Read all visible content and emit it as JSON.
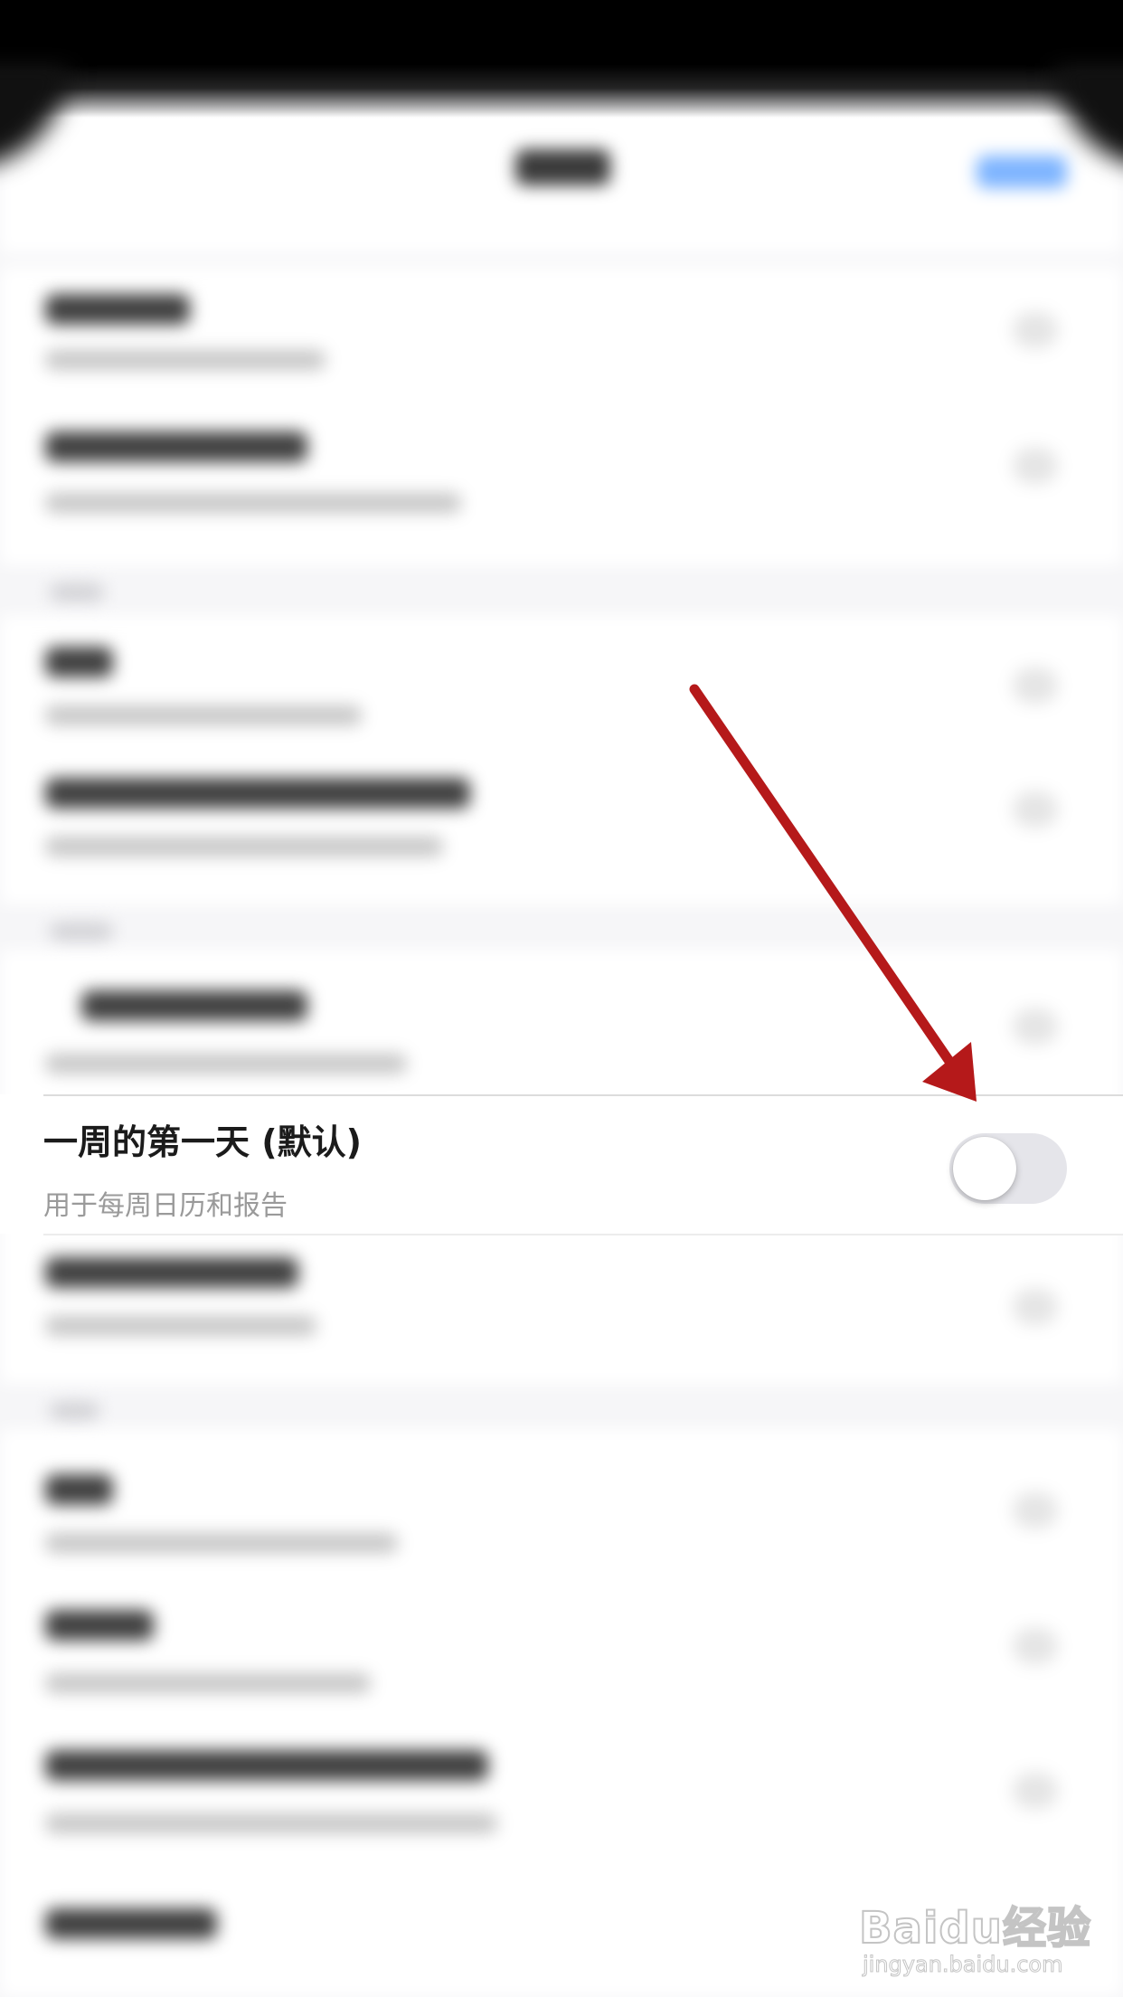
{
  "setting_row": {
    "title": "一周的第一天 (默认)",
    "subtitle": "用于每周日历和报告",
    "toggle_on": false
  },
  "watermark": {
    "logo_text": "Baidu经验",
    "url": "jingyan.baidu.com"
  },
  "annotation": {
    "arrow_color": "#b5191a"
  },
  "colors": {
    "toggle_off_track": "#e5e5ea",
    "title_text": "#1b1b1b",
    "subtitle_text": "#9a9a9a"
  }
}
